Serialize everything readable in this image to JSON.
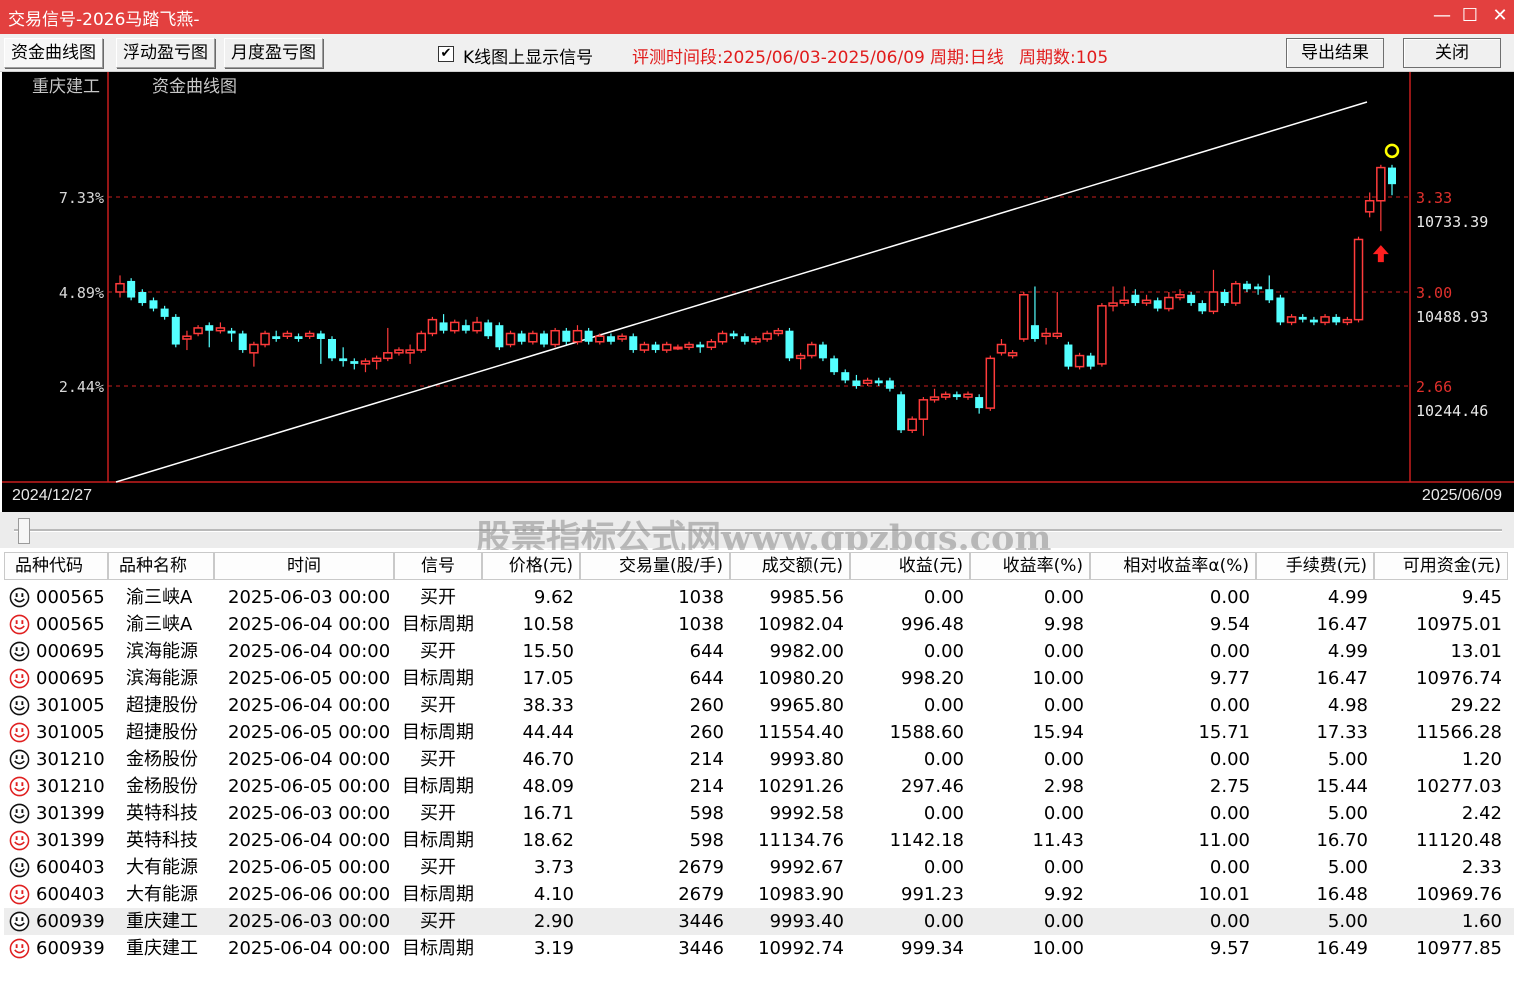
{
  "window": {
    "title": "交易信号-2026马踏飞燕-"
  },
  "toolbar": {
    "tabs": [
      "资金曲线图",
      "浮动盈亏图",
      "月度盈亏图"
    ],
    "checkbox_label": "K线图上显示信号",
    "checkbox_checked": true,
    "period_info": "评测时间段:2025/06/03-2025/06/09",
    "cycle_info": "周期:日线",
    "cycle_count": "周期数:105",
    "export_label": "导出结果",
    "close_label": "关闭"
  },
  "chart": {
    "stock_name": "重庆建工",
    "chart_title": "资金曲线图",
    "left_axis_labels": [
      "7.33%",
      "4.89%",
      "2.44%"
    ],
    "right_axis_price": [
      "3.33",
      "3.00",
      "2.66"
    ],
    "right_axis_capital": [
      "10733.39",
      "10488.93",
      "10244.46"
    ],
    "start_date": "2024/12/27",
    "end_date": "2025/06/09",
    "colors": {
      "up": "#ff3b3b",
      "down": "#54ffff",
      "equity_line": "#ffffff",
      "grid": "#c81e1e",
      "signal_circle": "#ffff00",
      "buy_arrow": "#ff2020"
    }
  },
  "watermark": "股票指标公式网www.gpzbgs.com",
  "table": {
    "columns": [
      "品种代码",
      "品种名称",
      "时间",
      "信号",
      "价格(元)",
      "交易量(股/手)",
      "成交额(元)",
      "收益(元)",
      "收益率(%)",
      "相对收益率α(%)",
      "手续费(元)",
      "可用资金(元)"
    ],
    "rows": [
      {
        "icon": "neutral",
        "code": "000565",
        "name": "渝三峡A",
        "time": "2025-06-03 00:00",
        "signal": "买开",
        "price": "9.62",
        "volume": "1038",
        "amount": "9985.56",
        "profit": "0.00",
        "rate": "0.00",
        "alpha": "0.00",
        "fee": "4.99",
        "cash": "9.45"
      },
      {
        "icon": "profit",
        "code": "000565",
        "name": "渝三峡A",
        "time": "2025-06-04 00:00",
        "signal": "目标周期",
        "price": "10.58",
        "volume": "1038",
        "amount": "10982.04",
        "profit": "996.48",
        "rate": "9.98",
        "alpha": "9.54",
        "fee": "16.47",
        "cash": "10975.01"
      },
      {
        "icon": "neutral",
        "code": "000695",
        "name": "滨海能源",
        "time": "2025-06-04 00:00",
        "signal": "买开",
        "price": "15.50",
        "volume": "644",
        "amount": "9982.00",
        "profit": "0.00",
        "rate": "0.00",
        "alpha": "0.00",
        "fee": "4.99",
        "cash": "13.01"
      },
      {
        "icon": "profit",
        "code": "000695",
        "name": "滨海能源",
        "time": "2025-06-05 00:00",
        "signal": "目标周期",
        "price": "17.05",
        "volume": "644",
        "amount": "10980.20",
        "profit": "998.20",
        "rate": "10.00",
        "alpha": "9.77",
        "fee": "16.47",
        "cash": "10976.74"
      },
      {
        "icon": "neutral",
        "code": "301005",
        "name": "超捷股份",
        "time": "2025-06-04 00:00",
        "signal": "买开",
        "price": "38.33",
        "volume": "260",
        "amount": "9965.80",
        "profit": "0.00",
        "rate": "0.00",
        "alpha": "0.00",
        "fee": "4.98",
        "cash": "29.22"
      },
      {
        "icon": "profit",
        "code": "301005",
        "name": "超捷股份",
        "time": "2025-06-05 00:00",
        "signal": "目标周期",
        "price": "44.44",
        "volume": "260",
        "amount": "11554.40",
        "profit": "1588.60",
        "rate": "15.94",
        "alpha": "15.71",
        "fee": "17.33",
        "cash": "11566.28"
      },
      {
        "icon": "neutral",
        "code": "301210",
        "name": "金杨股份",
        "time": "2025-06-04 00:00",
        "signal": "买开",
        "price": "46.70",
        "volume": "214",
        "amount": "9993.80",
        "profit": "0.00",
        "rate": "0.00",
        "alpha": "0.00",
        "fee": "5.00",
        "cash": "1.20"
      },
      {
        "icon": "profit",
        "code": "301210",
        "name": "金杨股份",
        "time": "2025-06-05 00:00",
        "signal": "目标周期",
        "price": "48.09",
        "volume": "214",
        "amount": "10291.26",
        "profit": "297.46",
        "rate": "2.98",
        "alpha": "2.75",
        "fee": "15.44",
        "cash": "10277.03"
      },
      {
        "icon": "neutral",
        "code": "301399",
        "name": "英特科技",
        "time": "2025-06-03 00:00",
        "signal": "买开",
        "price": "16.71",
        "volume": "598",
        "amount": "9992.58",
        "profit": "0.00",
        "rate": "0.00",
        "alpha": "0.00",
        "fee": "5.00",
        "cash": "2.42"
      },
      {
        "icon": "profit",
        "code": "301399",
        "name": "英特科技",
        "time": "2025-06-04 00:00",
        "signal": "目标周期",
        "price": "18.62",
        "volume": "598",
        "amount": "11134.76",
        "profit": "1142.18",
        "rate": "11.43",
        "alpha": "11.00",
        "fee": "16.70",
        "cash": "11120.48"
      },
      {
        "icon": "neutral",
        "code": "600403",
        "name": "大有能源",
        "time": "2025-06-05 00:00",
        "signal": "买开",
        "price": "3.73",
        "volume": "2679",
        "amount": "9992.67",
        "profit": "0.00",
        "rate": "0.00",
        "alpha": "0.00",
        "fee": "5.00",
        "cash": "2.33"
      },
      {
        "icon": "profit",
        "code": "600403",
        "name": "大有能源",
        "time": "2025-06-06 00:00",
        "signal": "目标周期",
        "price": "4.10",
        "volume": "2679",
        "amount": "10983.90",
        "profit": "991.23",
        "rate": "9.92",
        "alpha": "10.01",
        "fee": "16.48",
        "cash": "10969.76"
      },
      {
        "icon": "neutral",
        "code": "600939",
        "name": "重庆建工",
        "time": "2025-06-03 00:00",
        "signal": "买开",
        "price": "2.90",
        "volume": "3446",
        "amount": "9993.40",
        "profit": "0.00",
        "rate": "0.00",
        "alpha": "0.00",
        "fee": "5.00",
        "cash": "1.60",
        "selected": true
      },
      {
        "icon": "profit",
        "code": "600939",
        "name": "重庆建工",
        "time": "2025-06-04 00:00",
        "signal": "目标周期",
        "price": "3.19",
        "volume": "3446",
        "amount": "10992.74",
        "profit": "999.34",
        "rate": "10.00",
        "alpha": "9.57",
        "fee": "16.49",
        "cash": "10977.85"
      }
    ]
  },
  "chart_data": {
    "type": "candlestick",
    "title": "资金曲线图",
    "subtitle": "重庆建工",
    "x_range": [
      "2024/12/27",
      "2025/06/09"
    ],
    "price_axis_ticks": [
      3.33,
      3.0,
      2.66
    ],
    "capital_axis_ticks": [
      10733.39,
      10488.93,
      10244.46
    ],
    "return_axis_ticks_pct": [
      7.33,
      4.89,
      2.44
    ],
    "ylim_price": [
      2.4,
      3.5
    ],
    "equity_curve": {
      "start_pct": 0.0,
      "end_pct": 10.0
    },
    "candles": [
      {
        "o": 3.0,
        "c": 3.03,
        "h": 3.06,
        "l": 2.98
      },
      {
        "o": 3.04,
        "c": 2.98,
        "h": 3.05,
        "l": 2.97
      },
      {
        "o": 3.0,
        "c": 2.96,
        "h": 3.01,
        "l": 2.95
      },
      {
        "o": 2.97,
        "c": 2.94,
        "h": 2.98,
        "l": 2.93
      },
      {
        "o": 2.94,
        "c": 2.91,
        "h": 2.95,
        "l": 2.9
      },
      {
        "o": 2.91,
        "c": 2.81,
        "h": 2.92,
        "l": 2.8
      },
      {
        "o": 2.83,
        "c": 2.84,
        "h": 2.86,
        "l": 2.79
      },
      {
        "o": 2.85,
        "c": 2.87,
        "h": 2.88,
        "l": 2.84
      },
      {
        "o": 2.88,
        "c": 2.86,
        "h": 2.89,
        "l": 2.8
      },
      {
        "o": 2.86,
        "c": 2.87,
        "h": 2.89,
        "l": 2.85
      },
      {
        "o": 2.86,
        "c": 2.85,
        "h": 2.87,
        "l": 2.82
      },
      {
        "o": 2.85,
        "c": 2.79,
        "h": 2.86,
        "l": 2.78
      },
      {
        "o": 2.78,
        "c": 2.81,
        "h": 2.82,
        "l": 2.73
      },
      {
        "o": 2.81,
        "c": 2.85,
        "h": 2.86,
        "l": 2.8
      },
      {
        "o": 2.84,
        "c": 2.83,
        "h": 2.86,
        "l": 2.82
      },
      {
        "o": 2.84,
        "c": 2.85,
        "h": 2.86,
        "l": 2.83
      },
      {
        "o": 2.84,
        "c": 2.83,
        "h": 2.85,
        "l": 2.82
      },
      {
        "o": 2.84,
        "c": 2.85,
        "h": 2.86,
        "l": 2.83
      },
      {
        "o": 2.85,
        "c": 2.83,
        "h": 2.86,
        "l": 2.74
      },
      {
        "o": 2.83,
        "c": 2.76,
        "h": 2.84,
        "l": 2.75
      },
      {
        "o": 2.76,
        "c": 2.75,
        "h": 2.8,
        "l": 2.73
      },
      {
        "o": 2.75,
        "c": 2.74,
        "h": 2.76,
        "l": 2.72
      },
      {
        "o": 2.74,
        "c": 2.75,
        "h": 2.76,
        "l": 2.71
      },
      {
        "o": 2.75,
        "c": 2.76,
        "h": 2.77,
        "l": 2.72
      },
      {
        "o": 2.76,
        "c": 2.78,
        "h": 2.87,
        "l": 2.75
      },
      {
        "o": 2.78,
        "c": 2.79,
        "h": 2.8,
        "l": 2.77
      },
      {
        "o": 2.78,
        "c": 2.79,
        "h": 2.81,
        "l": 2.74
      },
      {
        "o": 2.79,
        "c": 2.85,
        "h": 2.86,
        "l": 2.78
      },
      {
        "o": 2.85,
        "c": 2.9,
        "h": 2.91,
        "l": 2.84
      },
      {
        "o": 2.89,
        "c": 2.86,
        "h": 2.92,
        "l": 2.85
      },
      {
        "o": 2.86,
        "c": 2.89,
        "h": 2.9,
        "l": 2.85
      },
      {
        "o": 2.88,
        "c": 2.86,
        "h": 2.9,
        "l": 2.85
      },
      {
        "o": 2.86,
        "c": 2.89,
        "h": 2.91,
        "l": 2.85
      },
      {
        "o": 2.89,
        "c": 2.84,
        "h": 2.9,
        "l": 2.83
      },
      {
        "o": 2.88,
        "c": 2.8,
        "h": 2.89,
        "l": 2.79
      },
      {
        "o": 2.81,
        "c": 2.85,
        "h": 2.86,
        "l": 2.8
      },
      {
        "o": 2.85,
        "c": 2.82,
        "h": 2.86,
        "l": 2.81
      },
      {
        "o": 2.82,
        "c": 2.85,
        "h": 2.86,
        "l": 2.81
      },
      {
        "o": 2.85,
        "c": 2.81,
        "h": 2.86,
        "l": 2.8
      },
      {
        "o": 2.81,
        "c": 2.86,
        "h": 2.87,
        "l": 2.8
      },
      {
        "o": 2.86,
        "c": 2.82,
        "h": 2.87,
        "l": 2.81
      },
      {
        "o": 2.82,
        "c": 2.86,
        "h": 2.88,
        "l": 2.81
      },
      {
        "o": 2.86,
        "c": 2.82,
        "h": 2.87,
        "l": 2.81
      },
      {
        "o": 2.82,
        "c": 2.84,
        "h": 2.85,
        "l": 2.81
      },
      {
        "o": 2.84,
        "c": 2.82,
        "h": 2.85,
        "l": 2.81
      },
      {
        "o": 2.83,
        "c": 2.84,
        "h": 2.85,
        "l": 2.82
      },
      {
        "o": 2.84,
        "c": 2.79,
        "h": 2.85,
        "l": 2.78
      },
      {
        "o": 2.79,
        "c": 2.81,
        "h": 2.82,
        "l": 2.78
      },
      {
        "o": 2.81,
        "c": 2.79,
        "h": 2.82,
        "l": 2.78
      },
      {
        "o": 2.79,
        "c": 2.81,
        "h": 2.82,
        "l": 2.78
      },
      {
        "o": 2.8,
        "c": 2.8,
        "h": 2.81,
        "l": 2.79
      },
      {
        "o": 2.8,
        "c": 2.81,
        "h": 2.82,
        "l": 2.79
      },
      {
        "o": 2.81,
        "c": 2.8,
        "h": 2.82,
        "l": 2.78
      },
      {
        "o": 2.8,
        "c": 2.82,
        "h": 2.83,
        "l": 2.79
      },
      {
        "o": 2.82,
        "c": 2.85,
        "h": 2.86,
        "l": 2.81
      },
      {
        "o": 2.85,
        "c": 2.84,
        "h": 2.86,
        "l": 2.83
      },
      {
        "o": 2.84,
        "c": 2.82,
        "h": 2.85,
        "l": 2.81
      },
      {
        "o": 2.82,
        "c": 2.83,
        "h": 2.84,
        "l": 2.81
      },
      {
        "o": 2.83,
        "c": 2.85,
        "h": 2.86,
        "l": 2.82
      },
      {
        "o": 2.85,
        "c": 2.86,
        "h": 2.87,
        "l": 2.84
      },
      {
        "o": 2.86,
        "c": 2.76,
        "h": 2.87,
        "l": 2.75
      },
      {
        "o": 2.76,
        "c": 2.77,
        "h": 2.78,
        "l": 2.72
      },
      {
        "o": 2.77,
        "c": 2.81,
        "h": 2.82,
        "l": 2.76
      },
      {
        "o": 2.81,
        "c": 2.76,
        "h": 2.82,
        "l": 2.75
      },
      {
        "o": 2.76,
        "c": 2.71,
        "h": 2.77,
        "l": 2.7
      },
      {
        "o": 2.71,
        "c": 2.68,
        "h": 2.72,
        "l": 2.67
      },
      {
        "o": 2.68,
        "c": 2.66,
        "h": 2.7,
        "l": 2.65
      },
      {
        "o": 2.67,
        "c": 2.68,
        "h": 2.69,
        "l": 2.66
      },
      {
        "o": 2.68,
        "c": 2.67,
        "h": 2.69,
        "l": 2.66
      },
      {
        "o": 2.68,
        "c": 2.65,
        "h": 2.69,
        "l": 2.64
      },
      {
        "o": 2.63,
        "c": 2.5,
        "h": 2.64,
        "l": 2.49
      },
      {
        "o": 2.5,
        "c": 2.54,
        "h": 2.55,
        "l": 2.49
      },
      {
        "o": 2.54,
        "c": 2.61,
        "h": 2.62,
        "l": 2.48
      },
      {
        "o": 2.61,
        "c": 2.62,
        "h": 2.65,
        "l": 2.6
      },
      {
        "o": 2.62,
        "c": 2.63,
        "h": 2.64,
        "l": 2.61
      },
      {
        "o": 2.63,
        "c": 2.62,
        "h": 2.64,
        "l": 2.61
      },
      {
        "o": 2.62,
        "c": 2.63,
        "h": 2.64,
        "l": 2.61
      },
      {
        "o": 2.62,
        "c": 2.58,
        "h": 2.63,
        "l": 2.56
      },
      {
        "o": 2.58,
        "c": 2.76,
        "h": 2.77,
        "l": 2.57
      },
      {
        "o": 2.78,
        "c": 2.81,
        "h": 2.83,
        "l": 2.77
      },
      {
        "o": 2.77,
        "c": 2.78,
        "h": 2.79,
        "l": 2.76
      },
      {
        "o": 2.83,
        "c": 2.99,
        "h": 3.0,
        "l": 2.82
      },
      {
        "o": 2.88,
        "c": 2.83,
        "h": 3.02,
        "l": 2.82
      },
      {
        "o": 2.84,
        "c": 2.85,
        "h": 2.87,
        "l": 2.81
      },
      {
        "o": 2.84,
        "c": 2.85,
        "h": 3.0,
        "l": 2.83
      },
      {
        "o": 2.81,
        "c": 2.73,
        "h": 2.82,
        "l": 2.72
      },
      {
        "o": 2.73,
        "c": 2.77,
        "h": 2.78,
        "l": 2.72
      },
      {
        "o": 2.77,
        "c": 2.73,
        "h": 2.78,
        "l": 2.72
      },
      {
        "o": 2.74,
        "c": 2.95,
        "h": 2.96,
        "l": 2.73
      },
      {
        "o": 2.95,
        "c": 2.96,
        "h": 3.02,
        "l": 2.93
      },
      {
        "o": 2.96,
        "c": 2.97,
        "h": 3.02,
        "l": 2.95
      },
      {
        "o": 2.99,
        "c": 2.96,
        "h": 3.01,
        "l": 2.95
      },
      {
        "o": 2.96,
        "c": 2.97,
        "h": 2.99,
        "l": 2.95
      },
      {
        "o": 2.97,
        "c": 2.94,
        "h": 2.98,
        "l": 2.93
      },
      {
        "o": 2.94,
        "c": 2.98,
        "h": 3.0,
        "l": 2.93
      },
      {
        "o": 2.98,
        "c": 2.99,
        "h": 3.01,
        "l": 2.97
      },
      {
        "o": 2.99,
        "c": 2.96,
        "h": 3.0,
        "l": 2.95
      },
      {
        "o": 2.96,
        "c": 2.93,
        "h": 2.97,
        "l": 2.92
      },
      {
        "o": 2.93,
        "c": 3.0,
        "h": 3.08,
        "l": 2.92
      },
      {
        "o": 3.0,
        "c": 2.96,
        "h": 3.01,
        "l": 2.95
      },
      {
        "o": 2.96,
        "c": 3.03,
        "h": 3.04,
        "l": 2.95
      },
      {
        "o": 3.03,
        "c": 3.01,
        "h": 3.04,
        "l": 3.0
      },
      {
        "o": 3.02,
        "c": 3.01,
        "h": 3.03,
        "l": 2.99
      },
      {
        "o": 3.01,
        "c": 2.97,
        "h": 3.06,
        "l": 2.96
      },
      {
        "o": 2.98,
        "c": 2.89,
        "h": 2.99,
        "l": 2.88
      },
      {
        "o": 2.89,
        "c": 2.91,
        "h": 2.92,
        "l": 2.88
      },
      {
        "o": 2.91,
        "c": 2.9,
        "h": 2.92,
        "l": 2.89
      },
      {
        "o": 2.9,
        "c": 2.89,
        "h": 2.91,
        "l": 2.88
      },
      {
        "o": 2.89,
        "c": 2.91,
        "h": 2.92,
        "l": 2.88
      },
      {
        "o": 2.91,
        "c": 2.89,
        "h": 2.92,
        "l": 2.88
      },
      {
        "o": 2.89,
        "c": 2.9,
        "h": 2.91,
        "l": 2.88
      },
      {
        "o": 2.9,
        "c": 3.19,
        "h": 3.2,
        "l": 2.89
      },
      {
        "o": 3.29,
        "c": 3.33,
        "h": 3.36,
        "l": 3.27
      },
      {
        "o": 3.33,
        "c": 3.45,
        "h": 3.46,
        "l": 3.22
      },
      {
        "o": 3.45,
        "c": 3.39,
        "h": 3.46,
        "l": 3.35
      }
    ],
    "signals": [
      {
        "index": 113,
        "type": "buy",
        "marker": "up-arrow"
      },
      {
        "index": 114,
        "type": "target",
        "marker": "circle"
      }
    ]
  }
}
